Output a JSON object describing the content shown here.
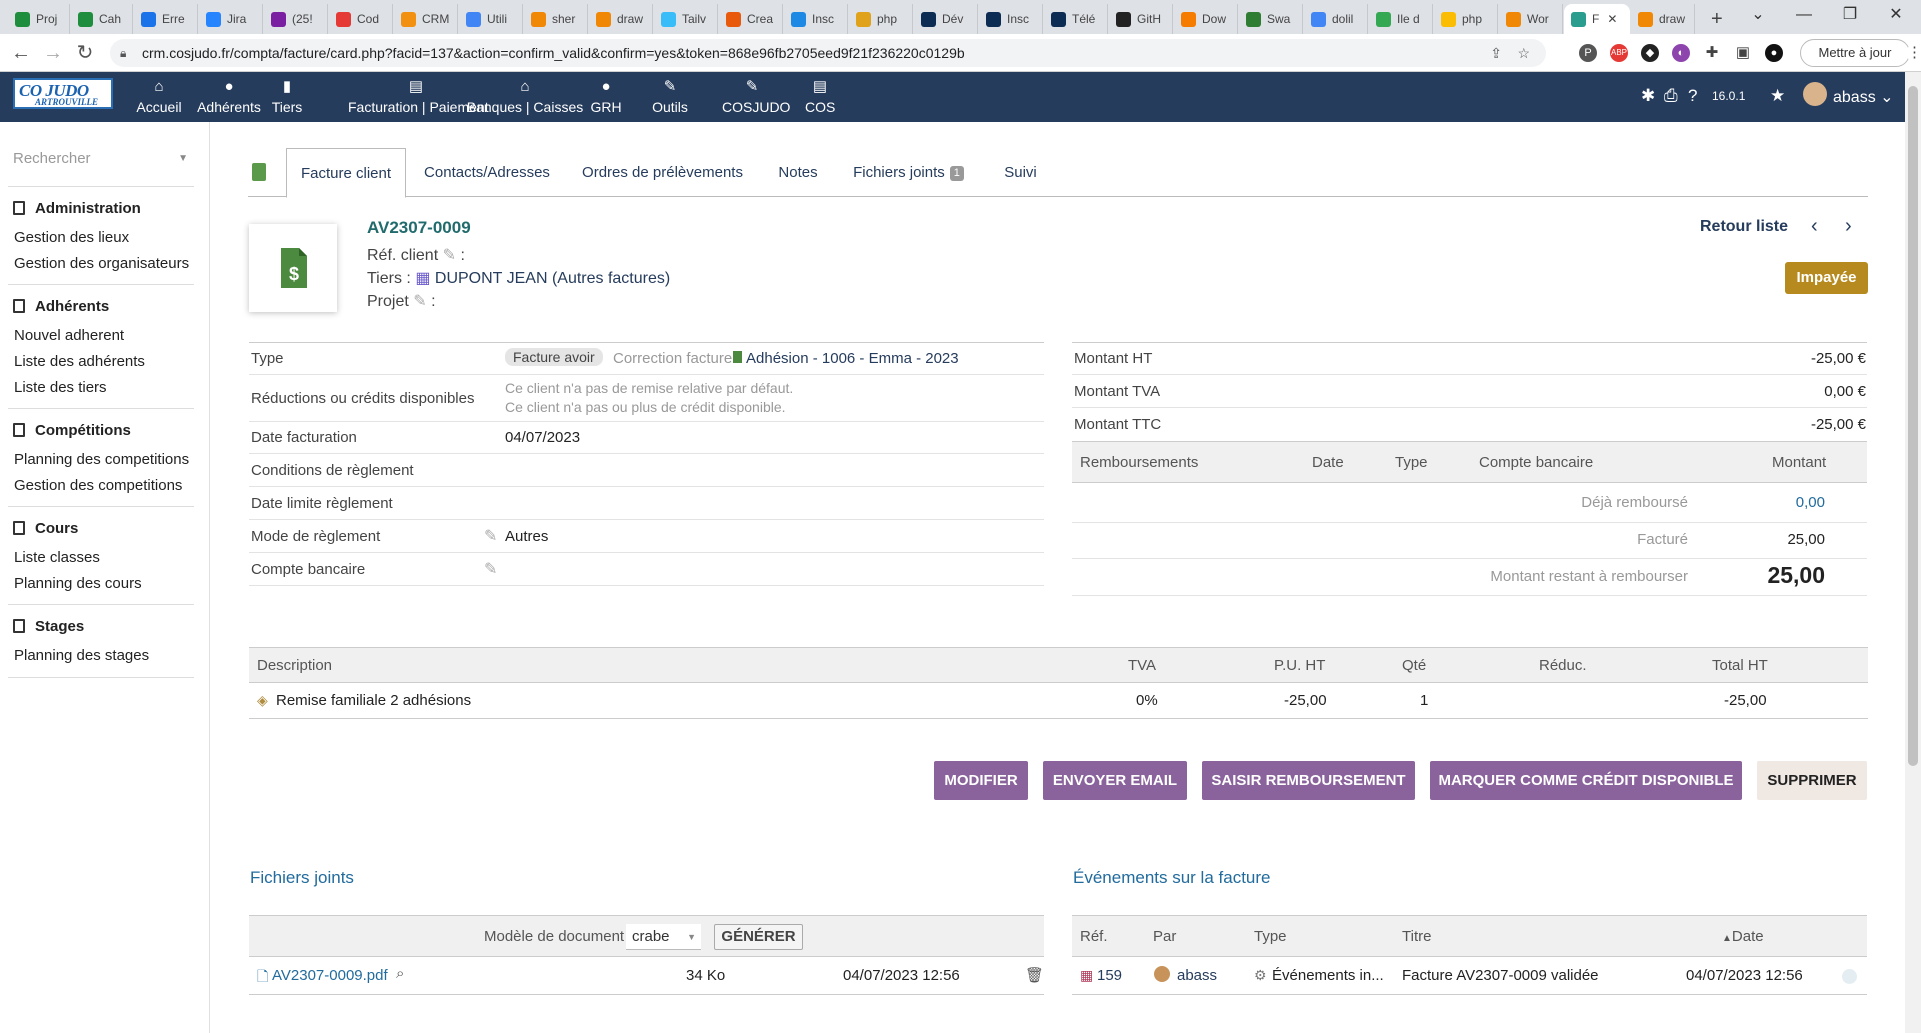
{
  "browser": {
    "tabs": [
      {
        "label": "Proj",
        "color": "#1e8e3e"
      },
      {
        "label": "Cah",
        "color": "#1e8e3e"
      },
      {
        "label": "Erre",
        "color": "#1a73e8"
      },
      {
        "label": "Jira",
        "color": "#2684ff"
      },
      {
        "label": "(25!",
        "color": "#7b1fa2"
      },
      {
        "label": "Cod",
        "color": "#e53935"
      },
      {
        "label": "CRM",
        "color": "#f29111"
      },
      {
        "label": "Utili",
        "color": "#4285f4"
      },
      {
        "label": "sher",
        "color": "#f08705"
      },
      {
        "label": "draw",
        "color": "#f08705"
      },
      {
        "label": "Tailv",
        "color": "#38bdf8"
      },
      {
        "label": "Crea",
        "color": "#e8590c"
      },
      {
        "label": "Insc",
        "color": "#1e88e5"
      },
      {
        "label": "php",
        "color": "#e0a21a"
      },
      {
        "label": "Dév",
        "color": "#0d2c54"
      },
      {
        "label": "Insc",
        "color": "#0d2c54"
      },
      {
        "label": "Télé",
        "color": "#0d2c54"
      },
      {
        "label": "GitH",
        "color": "#222222"
      },
      {
        "label": "Dow",
        "color": "#f57c00"
      },
      {
        "label": "Swa",
        "color": "#2e7d32"
      },
      {
        "label": "dolil",
        "color": "#4285f4"
      },
      {
        "label": "Ile d",
        "color": "#34a853"
      },
      {
        "label": "php",
        "color": "#fbbc04"
      },
      {
        "label": "Wor",
        "color": "#f08705"
      },
      {
        "label": "F",
        "color": "#2a9d8f"
      },
      {
        "label": "draw",
        "color": "#f08705"
      }
    ],
    "url": "crm.cosjudo.fr/compta/facture/card.php?facid=137&action=confirm_valid&confirm=yes&token=868e96fb2705eed9f21f236220c0129b",
    "update_label": "Mettre à jour"
  },
  "app": {
    "logo_line1": "CO JUDO",
    "logo_line2": "ARTROUVILLE",
    "menu": [
      {
        "label": "Accueil",
        "icon": "home-icon",
        "glyph": "⌂"
      },
      {
        "label": "Adhérents",
        "icon": "user-icon",
        "glyph": "●"
      },
      {
        "label": "Tiers",
        "icon": "building-icon",
        "glyph": "▮"
      },
      {
        "label": "Facturation | Paiement",
        "icon": "invoice-icon",
        "glyph": "▤"
      },
      {
        "label": "Banques | Caisses",
        "icon": "bank-icon",
        "glyph": "⌂"
      },
      {
        "label": "GRH",
        "icon": "user-tie-icon",
        "glyph": "●"
      },
      {
        "label": "Outils",
        "icon": "wrench-icon",
        "glyph": "✎"
      },
      {
        "label": "COSJUDO",
        "icon": "edit-icon",
        "glyph": "✎"
      },
      {
        "label": "COS",
        "icon": "note-icon",
        "glyph": "▤"
      }
    ],
    "version": "16.0.1",
    "user": "abass"
  },
  "left_menu": {
    "search_placeholder": "Rechercher",
    "sections": [
      {
        "title": "Administration",
        "items": [
          "Gestion des lieux",
          "Gestion des organisateurs"
        ]
      },
      {
        "title": "Adhérents",
        "items": [
          "Nouvel adherent",
          "Liste des adhérents",
          "Liste des tiers"
        ]
      },
      {
        "title": "Compétitions",
        "items": [
          "Planning des competitions",
          "Gestion des competitions"
        ]
      },
      {
        "title": "Cours",
        "items": [
          "Liste classes",
          "Planning des cours"
        ]
      },
      {
        "title": "Stages",
        "items": [
          "Planning des stages"
        ]
      }
    ]
  },
  "tabs": {
    "facture": "Facture client",
    "contacts": "Contacts/Adresses",
    "prelevements": "Ordres de prélèvements",
    "notes": "Notes",
    "fichiers": "Fichiers joints",
    "fichiers_count": "1",
    "suivi": "Suivi"
  },
  "invoice": {
    "ref": "AV2307-0009",
    "ref_client_label": "Réf. client",
    "tiers_label": "Tiers :",
    "tiers_value": "DUPONT JEAN (Autres factures)",
    "projet_label": "Projet",
    "back_label": "Retour liste",
    "status": "Impayée",
    "fields": {
      "type_label": "Type",
      "type_badge": "Facture avoir",
      "correction_label": "Correction facture",
      "correction_link": "Adhésion - 1006 - Emma - 2023",
      "reductions_label": "Réductions ou crédits disponibles",
      "reduction_note1": "Ce client n'a pas de remise relative par défaut.",
      "reduction_note2": "Ce client n'a pas ou plus de crédit disponible.",
      "date_label": "Date facturation",
      "date_value": "04/07/2023",
      "conditions_label": "Conditions de règlement",
      "limite_label": "Date limite règlement",
      "mode_label": "Mode de règlement",
      "mode_value": "Autres",
      "compte_label": "Compte bancaire"
    },
    "totals": {
      "ht_label": "Montant HT",
      "ht_value": "-25,00 €",
      "tva_label": "Montant TVA",
      "tva_value": "0,00 €",
      "ttc_label": "Montant TTC",
      "ttc_value": "-25,00 €"
    },
    "refunds": {
      "headers": [
        "Remboursements",
        "Date",
        "Type",
        "Compte bancaire",
        "Montant"
      ],
      "deja_label": "Déjà remboursé",
      "deja_value": "0,00",
      "facture_label": "Facturé",
      "facture_value": "25,00",
      "restant_label": "Montant restant à rembourser",
      "restant_value": "25,00"
    },
    "lines": {
      "headers": [
        "Description",
        "TVA",
        "P.U. HT",
        "Qté",
        "Réduc.",
        "Total HT"
      ],
      "rows": [
        {
          "description": "Remise familiale 2 adhésions",
          "tva": "0%",
          "pu": "-25,00",
          "qte": "1",
          "reduc": "",
          "total": "-25,00"
        }
      ]
    },
    "actions": [
      "MODIFIER",
      "ENVOYER EMAIL",
      "SAISIR REMBOURSEMENT",
      "MARQUER COMME CRÉDIT DISPONIBLE",
      "SUPPRIMER"
    ]
  },
  "files": {
    "title": "Fichiers joints",
    "model_label": "Modèle de document",
    "model_value": "crabe",
    "generate_label": "GÉNÉRER",
    "file_name": "AV2307-0009.pdf",
    "file_size": "34 Ko",
    "file_date": "04/07/2023 12:56"
  },
  "events": {
    "title": "Événements sur la facture",
    "headers": [
      "Réf.",
      "Par",
      "Type",
      "Titre",
      "Date"
    ],
    "row": {
      "ref": "159",
      "by": "abass",
      "type": "Événements in...",
      "title": "Facture AV2307-0009 validée",
      "date": "04/07/2023 12:56"
    }
  },
  "colors": {
    "nav": "#263c5c",
    "button": "#8a629c",
    "status": "#b68a1e",
    "link": "#216b6d"
  }
}
